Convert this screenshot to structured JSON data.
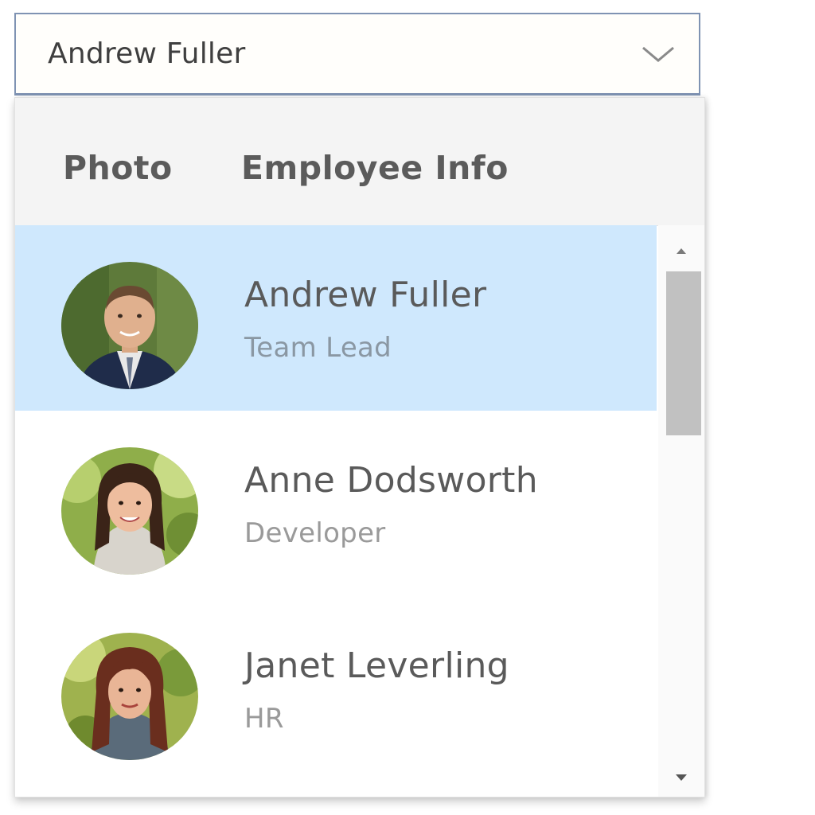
{
  "combobox": {
    "selected_value": "Andrew Fuller",
    "arrow_icon": "chevron-down-icon"
  },
  "popup": {
    "header": {
      "photo_label": "Photo",
      "info_label": "Employee Info"
    },
    "employees": [
      {
        "name": "Andrew Fuller",
        "role": "Team Lead",
        "selected": true
      },
      {
        "name": "Anne Dodsworth",
        "role": "Developer",
        "selected": false
      },
      {
        "name": "Janet Leverling",
        "role": "HR",
        "selected": false
      }
    ],
    "scrollbar": {
      "up_icon": "triangle-up-icon",
      "down_icon": "triangle-down-icon"
    }
  },
  "colors": {
    "selected_row": "#cfe8fd",
    "combo_border": "#7f93b3",
    "header_bg": "#f4f4f4",
    "scroll_thumb": "#c1c1c1"
  }
}
